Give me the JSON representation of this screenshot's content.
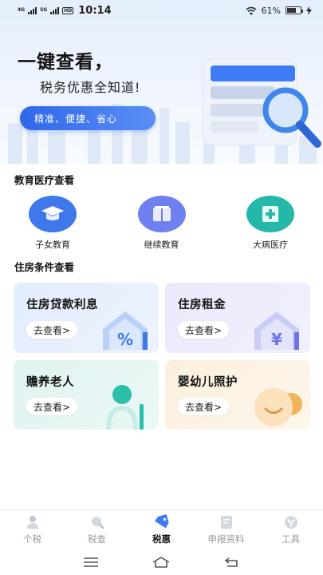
{
  "status_bar": {
    "signal_1": "4G",
    "signal_2": "5G",
    "hd": "HD",
    "time": "10:14",
    "battery": "61%"
  },
  "banner": {
    "title": "一键查看，",
    "subtitle": "税务优惠全知道!",
    "pill": "精准、便捷、省心"
  },
  "education": {
    "title": "教育医疗查看",
    "items": [
      {
        "label": "子女教育",
        "icon": "graduation-cap-icon",
        "color": "#3e78ea"
      },
      {
        "label": "继续教育",
        "icon": "book-icon",
        "color": "#6f7ff0"
      },
      {
        "label": "大病医疗",
        "icon": "medical-icon",
        "color": "#25b8a9"
      }
    ]
  },
  "housing": {
    "title": "住房条件查看",
    "cards": [
      {
        "title": "住房贷款利息",
        "button": "去查看>",
        "icon": "house-percent-icon"
      },
      {
        "title": "住房租金",
        "button": "去查看>",
        "icon": "house-yuan-icon"
      },
      {
        "title": "赡养老人",
        "button": "去查看>",
        "icon": "elderly-person-icon"
      },
      {
        "title": "婴幼儿照护",
        "button": "去查看>",
        "icon": "baby-face-icon"
      }
    ]
  },
  "tabs": [
    {
      "label": "个税",
      "icon": "person-icon",
      "active": false
    },
    {
      "label": "税查",
      "icon": "search-icon",
      "active": false
    },
    {
      "label": "税惠",
      "icon": "tag-icon",
      "active": true
    },
    {
      "label": "申报资料",
      "icon": "document-icon",
      "active": false
    },
    {
      "label": "工具",
      "icon": "tools-icon",
      "active": false
    }
  ],
  "colors": {
    "accent": "#2f66e8",
    "teal": "#25b8a9",
    "tab_inactive": "#999999"
  }
}
